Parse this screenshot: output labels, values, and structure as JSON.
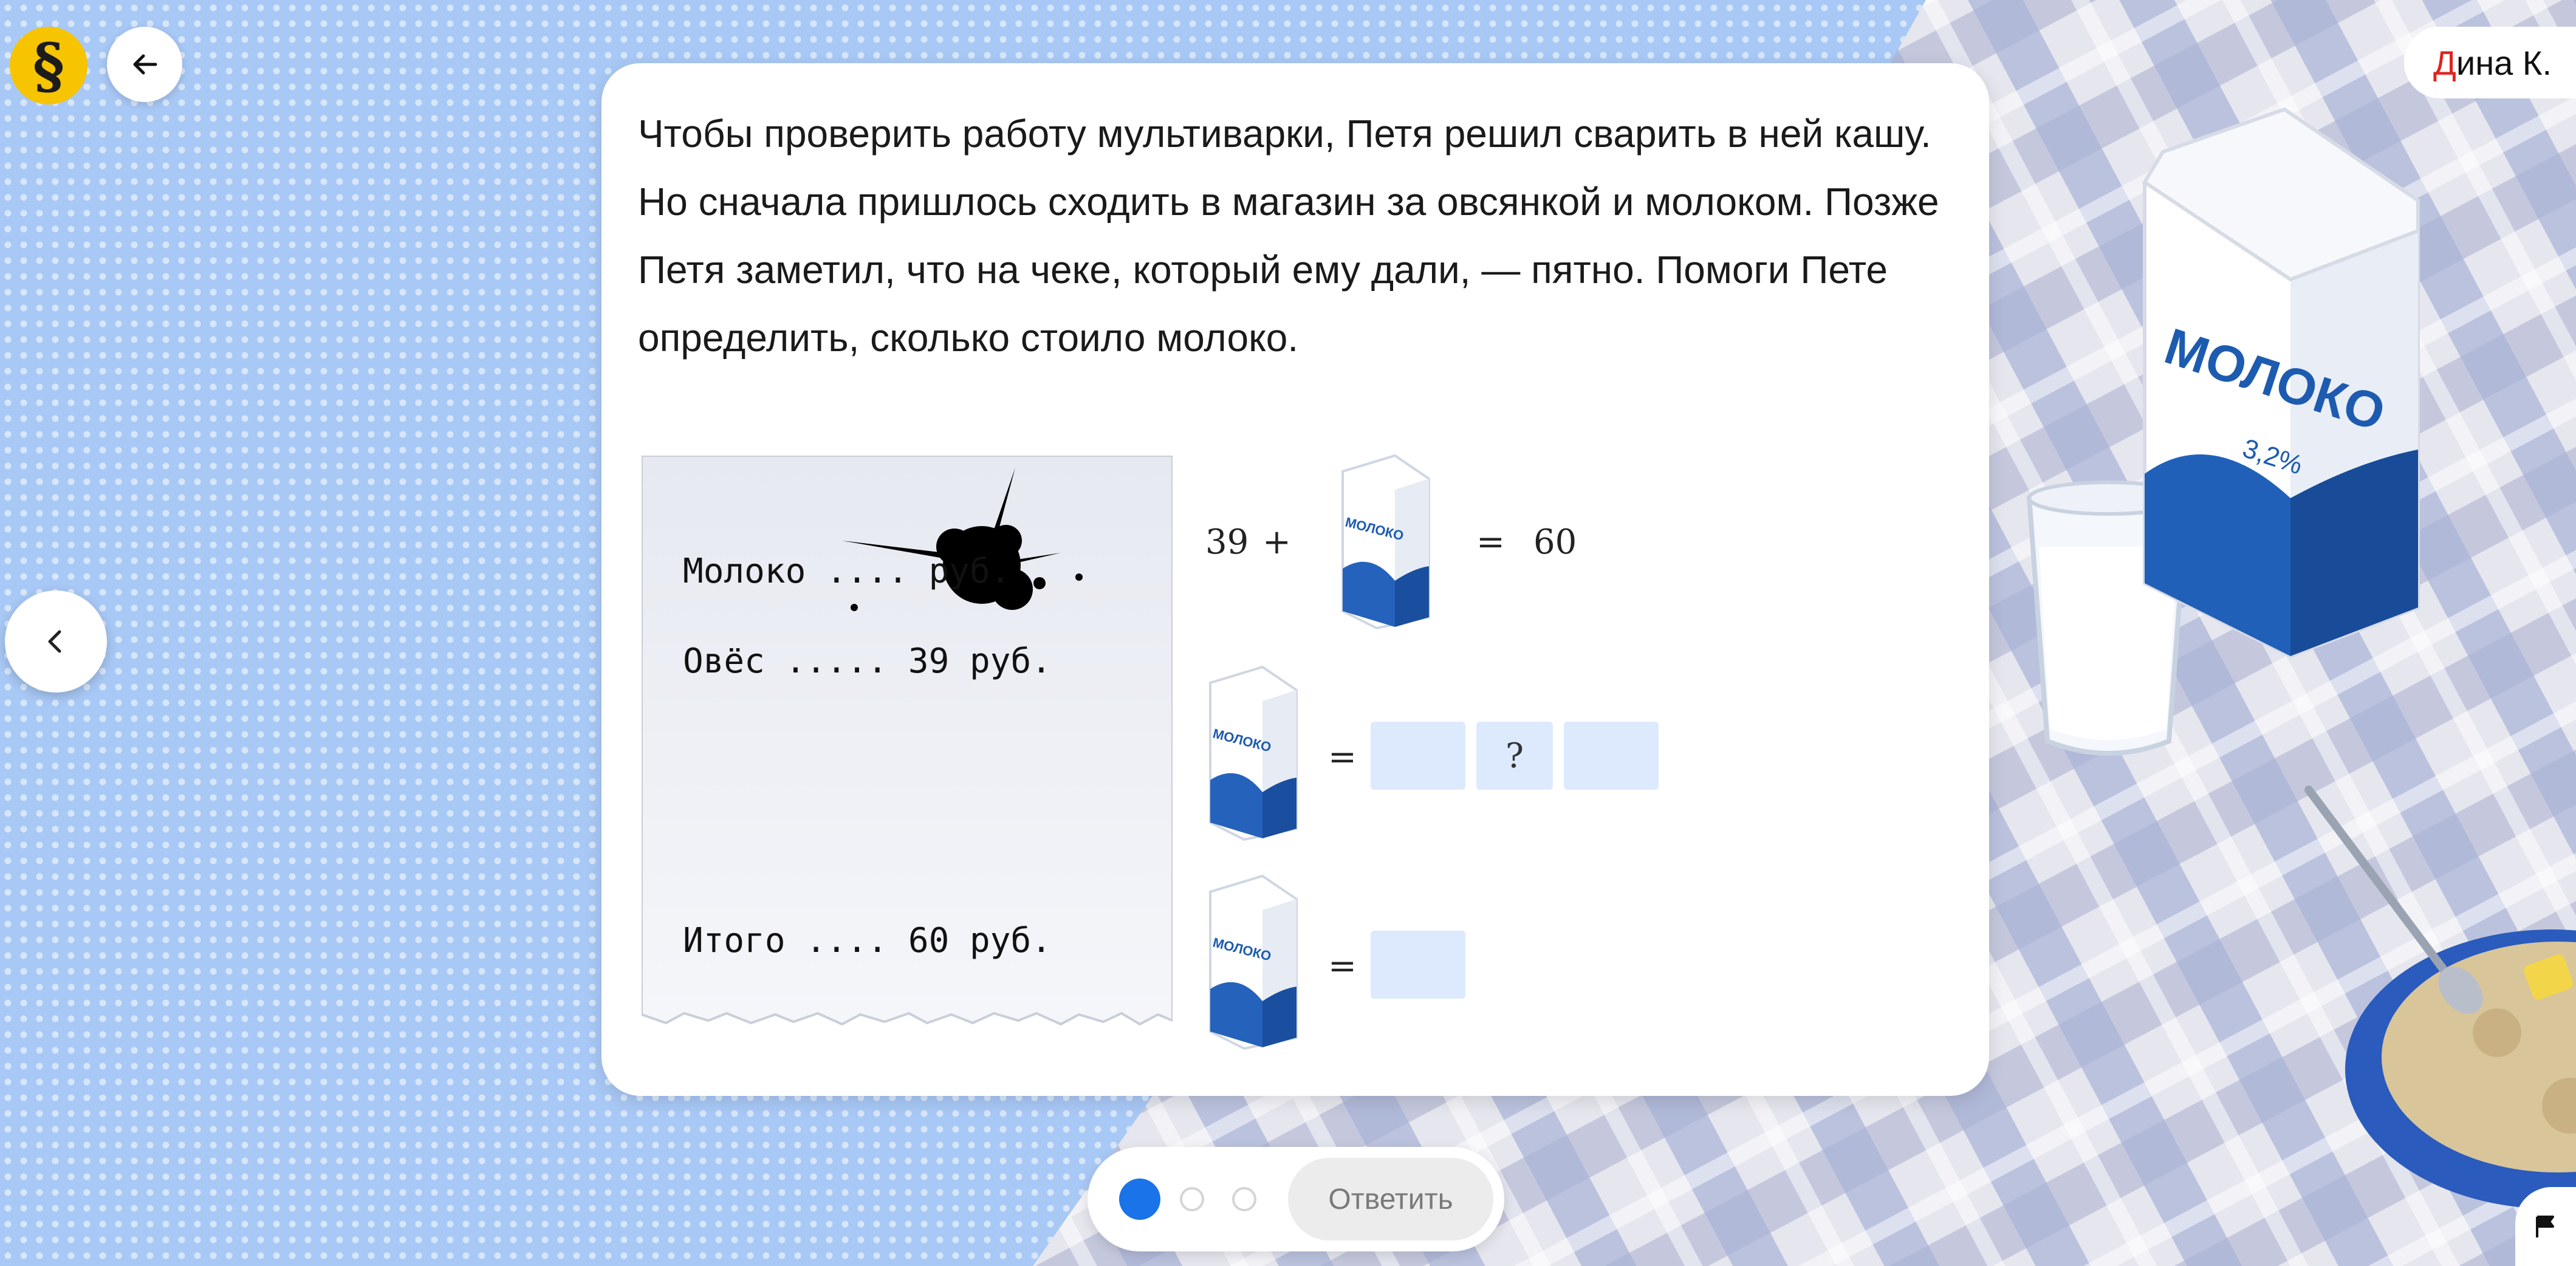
{
  "header": {
    "logo_icon": "paragraph-icon",
    "logo_glyph": "§",
    "back_icon": "arrow-left-icon",
    "user_initial": "Д",
    "user_rest": "ина К."
  },
  "task": {
    "text": "Чтобы проверить работу мультиварки, Петя решил сварить в ней кашу. Но сначала пришлось сходить в магазин за овсянкой и молоком. Позже Петя заметил, что на чеке, который ему дали, — пятно. Помоги Пете определить, сколько стоило молоко."
  },
  "receipt": {
    "line_milk": "Молоко .... руб.",
    "line_oats": "Овёс ..... 39 руб.",
    "line_total": "Итого .... 60 руб."
  },
  "equation1": {
    "left": "39",
    "plus": "+",
    "equals": "=",
    "right": "60"
  },
  "equation2": {
    "equals": "=",
    "placeholder": "?"
  },
  "equation3": {
    "equals": "="
  },
  "milk_label": "МОЛОКО",
  "milk_percent": "3,2%",
  "footer": {
    "submit_label": "Ответить",
    "step_count": 3,
    "current_step": 1
  },
  "colors": {
    "accent": "#1a73e8",
    "logo": "#f6c400",
    "input": "#ddeafd",
    "user_initial": "#e0231e"
  },
  "nav": {
    "prev_icon": "chevron-left-icon",
    "flag_icon": "flag-icon"
  }
}
